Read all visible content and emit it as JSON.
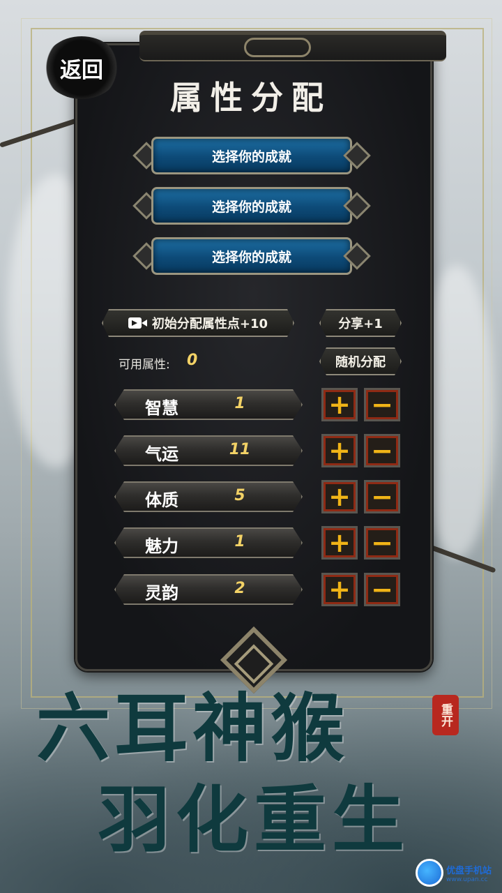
{
  "nav": {
    "back_label": "返回"
  },
  "header": {
    "title": "属性分配"
  },
  "achievements": [
    {
      "label": "选择你的成就"
    },
    {
      "label": "选择你的成就"
    },
    {
      "label": "选择你的成就"
    }
  ],
  "actions": {
    "initial_points_label": "初始分配属性点+10",
    "share_label": "分享+1",
    "random_label": "随机分配"
  },
  "available": {
    "label": "可用属性:",
    "value": "0"
  },
  "stats": [
    {
      "name": "智慧",
      "value": "1"
    },
    {
      "name": "气运",
      "value": "11"
    },
    {
      "name": "体质",
      "value": "5"
    },
    {
      "name": "魅力",
      "value": "1"
    },
    {
      "name": "灵韵",
      "value": "2"
    }
  ],
  "controls": {
    "plus": "+",
    "minus": "−"
  },
  "banner": {
    "line1": "六耳神猴",
    "line2": "羽化重生",
    "seal": "重开"
  },
  "watermark": {
    "main": "优盘手机站",
    "sub": "www.upan.cc"
  },
  "icons": {
    "video": "video-camera-icon"
  },
  "colors": {
    "gold": "#f3d266",
    "button_blue": "#0d4a77",
    "plus_minus": "#f1b417"
  }
}
